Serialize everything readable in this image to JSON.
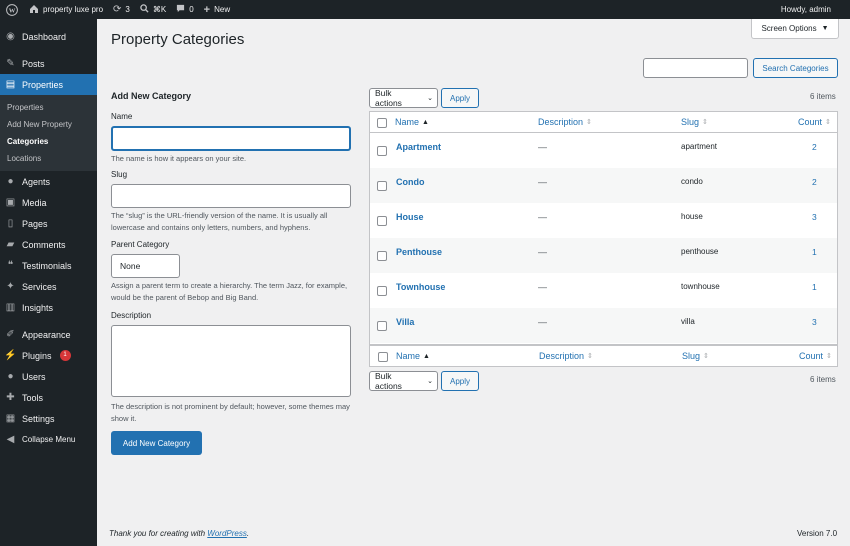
{
  "adminbar": {
    "site_name": "property luxe pro",
    "updates_count": "3",
    "shortcut": "⌘K",
    "comments_count": "0",
    "new_label": "New",
    "greeting": "Howdy, admin"
  },
  "sidebar": {
    "dashboard": "Dashboard",
    "posts": "Posts",
    "properties": "Properties",
    "sub_items": [
      "Properties",
      "Add New Property",
      "Categories",
      "Locations"
    ],
    "agents": "Agents",
    "media": "Media",
    "pages": "Pages",
    "comments": "Comments",
    "testimonials": "Testimonials",
    "services": "Services",
    "insights": "Insights",
    "appearance": "Appearance",
    "plugins": "Plugins",
    "plugins_badge": "1",
    "users": "Users",
    "tools": "Tools",
    "settings": "Settings",
    "collapse": "Collapse Menu"
  },
  "page": {
    "title": "Property Categories",
    "screen_options": "Screen Options",
    "search_button": "Search Categories",
    "search_value": ""
  },
  "form": {
    "heading": "Add New Category",
    "name_label": "Name",
    "name_value": "",
    "name_help": "The name is how it appears on your site.",
    "slug_label": "Slug",
    "slug_value": "",
    "slug_help": "The “slug” is the URL-friendly version of the name. It is usually all lowercase and contains only letters, numbers, and hyphens.",
    "parent_label": "Parent Category",
    "parent_value": "None",
    "parent_help": "Assign a parent term to create a hierarchy. The term Jazz, for example, would be the parent of Bebop and Big Band.",
    "description_label": "Description",
    "description_value": "",
    "description_help": "The description is not prominent by default; however, some themes may show it.",
    "submit_label": "Add New Category"
  },
  "table": {
    "bulk_actions": "Bulk actions",
    "apply": "Apply",
    "items_count": "6 items",
    "columns": {
      "name": "Name",
      "description": "Description",
      "slug": "Slug",
      "count": "Count"
    },
    "rows": [
      {
        "name": "Apartment",
        "description": "—",
        "slug": "apartment",
        "count": "2"
      },
      {
        "name": "Condo",
        "description": "—",
        "slug": "condo",
        "count": "2"
      },
      {
        "name": "House",
        "description": "—",
        "slug": "house",
        "count": "3"
      },
      {
        "name": "Penthouse",
        "description": "—",
        "slug": "penthouse",
        "count": "1"
      },
      {
        "name": "Townhouse",
        "description": "—",
        "slug": "townhouse",
        "count": "1"
      },
      {
        "name": "Villa",
        "description": "—",
        "slug": "villa",
        "count": "3"
      }
    ]
  },
  "footer": {
    "thanks_prefix": "Thank you for creating with ",
    "thanks_link": "WordPress",
    "thanks_suffix": ".",
    "version": "Version 7.0"
  }
}
